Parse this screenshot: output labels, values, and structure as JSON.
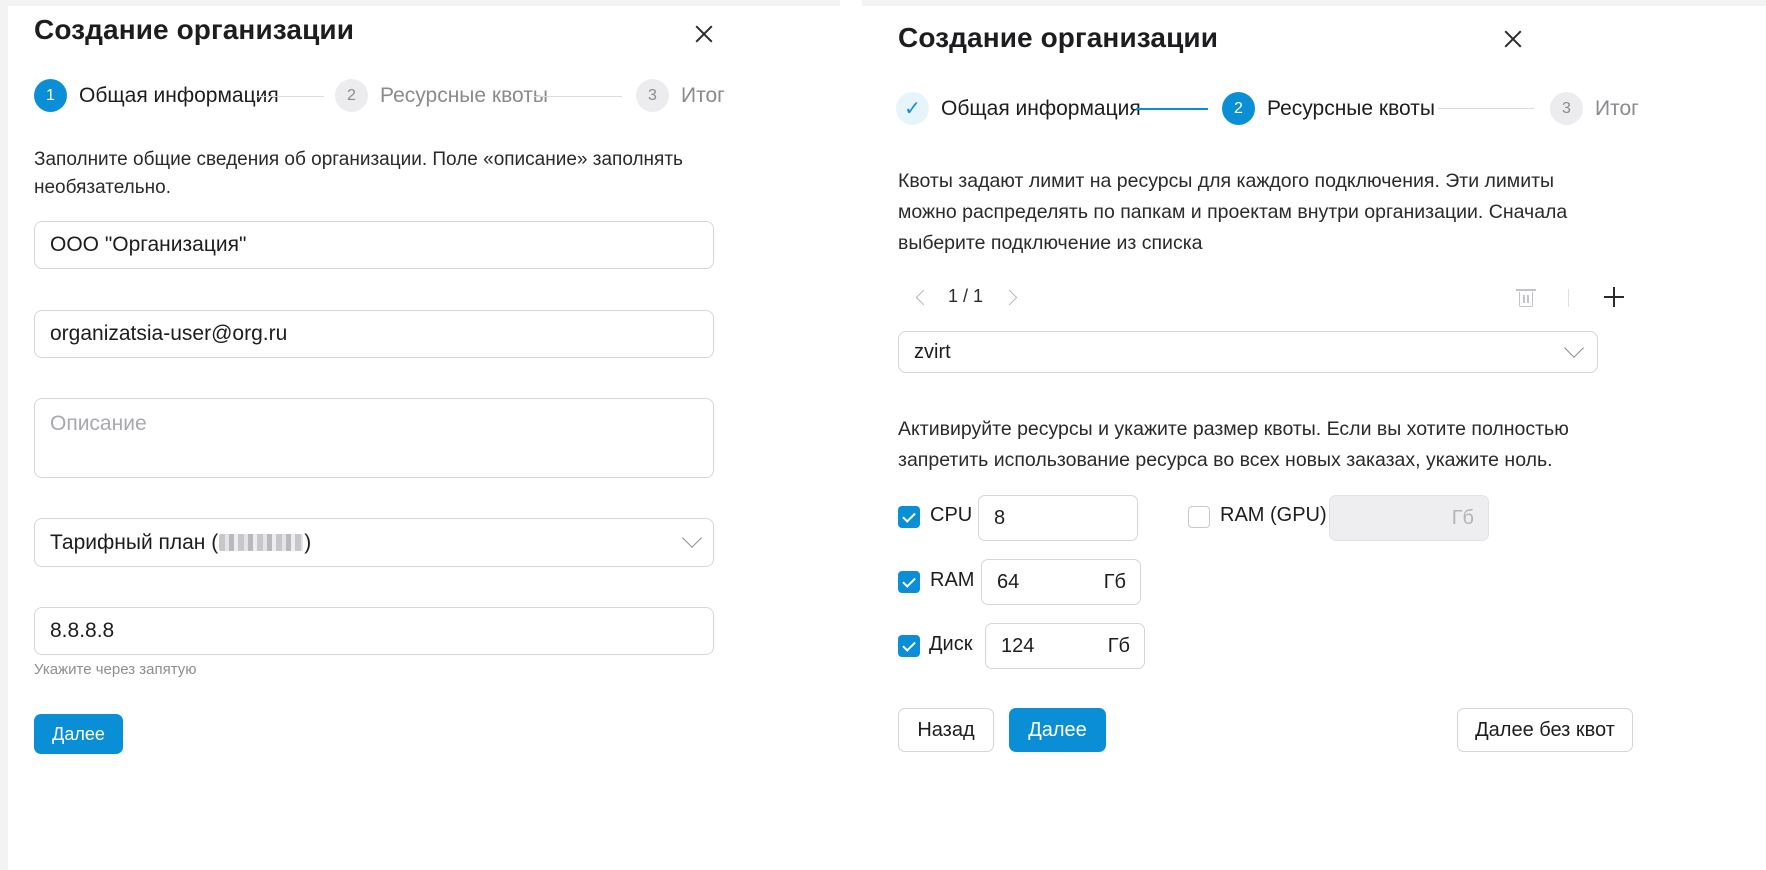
{
  "left": {
    "title": "Создание организации",
    "steps": [
      {
        "num": "1",
        "label": "Общая информация"
      },
      {
        "num": "2",
        "label": "Ресурсные квоты"
      },
      {
        "num": "3",
        "label": "Итог"
      }
    ],
    "intro": "Заполните общие сведения об организации. Поле «описание» заполнять необязательно.",
    "name_value": "ООО \"Организация\"",
    "email_value": "organizatsia-user@org.ru",
    "description_placeholder": "Описание",
    "tariff_prefix": "Тарифный план (",
    "tariff_suffix": ")",
    "dns_value": "8.8.8.8",
    "dns_hint": "Укажите через запятую",
    "next_label": "Далее"
  },
  "right": {
    "title": "Создание организации",
    "steps": [
      {
        "num": "✓",
        "label": "Общая информация"
      },
      {
        "num": "2",
        "label": "Ресурсные квоты"
      },
      {
        "num": "3",
        "label": "Итог"
      }
    ],
    "intro": "Квоты задают лимит на ресурсы для каждого подключения. Эти лимиты можно распределять по папкам и проектам внутри организации. Сначала выберите подключение из списка",
    "pager": "1 / 1",
    "connection_value": "zvirt",
    "resources_text": "Активируйте ресурсы и укажите размер квоты. Если вы хотите полностью запретить использование ресурса во всех новых заказах, укажите ноль.",
    "quotas": {
      "cpu": {
        "label": "CPU",
        "value": "8",
        "unit": "",
        "checked": true
      },
      "ram": {
        "label": "RAM",
        "value": "64",
        "unit": "Гб",
        "checked": true
      },
      "disk": {
        "label": "Диск",
        "value": "124",
        "unit": "Гб",
        "checked": true
      },
      "ram_gpu": {
        "label": "RAM (GPU)",
        "value": "",
        "unit": "Гб",
        "checked": false
      }
    },
    "back_label": "Назад",
    "next_label": "Далее",
    "skip_label": "Далее без квот"
  },
  "colors": {
    "accent": "#0a8fd6",
    "border": "#d6d6da",
    "muted": "#8a8a8f"
  }
}
